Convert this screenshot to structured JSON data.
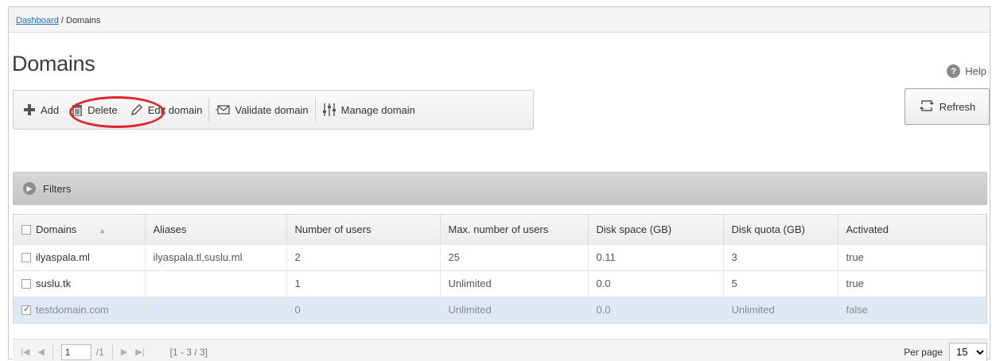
{
  "breadcrumb": {
    "dashboard": "Dashboard",
    "separator": " / ",
    "current": "Domains"
  },
  "page_title": "Domains",
  "help_label": "Help",
  "toolbar": {
    "add": "Add",
    "delete": "Delete",
    "edit_domain": "Edit domain",
    "validate_domain": "Validate domain",
    "manage_domain": "Manage domain"
  },
  "refresh_label": "Refresh",
  "filters_label": "Filters",
  "table": {
    "columns": [
      "Domains",
      "Aliases",
      "Number of users",
      "Max. number of users",
      "Disk space (GB)",
      "Disk quota (GB)",
      "Activated"
    ],
    "rows": [
      {
        "checked": false,
        "domain": "ilyaspala.ml",
        "aliases": "ilyaspala.tl,suslu.ml",
        "users": "2",
        "max_users": "25",
        "disk_space": "0.11",
        "disk_quota": "3",
        "activated": "true"
      },
      {
        "checked": false,
        "domain": "suslu.tk",
        "aliases": "",
        "users": "1",
        "max_users": "Unlimited",
        "disk_space": "0.0",
        "disk_quota": "5",
        "activated": "true"
      },
      {
        "checked": true,
        "domain": "testdomain.com",
        "aliases": "",
        "users": "0",
        "max_users": "Unlimited",
        "disk_space": "0.0",
        "disk_quota": "Unlimited",
        "activated": "false"
      }
    ]
  },
  "pager": {
    "page": "1",
    "total_pages": "/1",
    "range": "[1 - 3 / 3]",
    "per_page_label": "Per page",
    "per_page_value": "15"
  },
  "colors": {
    "annotation": "#e0252b",
    "link": "#2a6fc4",
    "selected_row": "#dfe9f6"
  }
}
